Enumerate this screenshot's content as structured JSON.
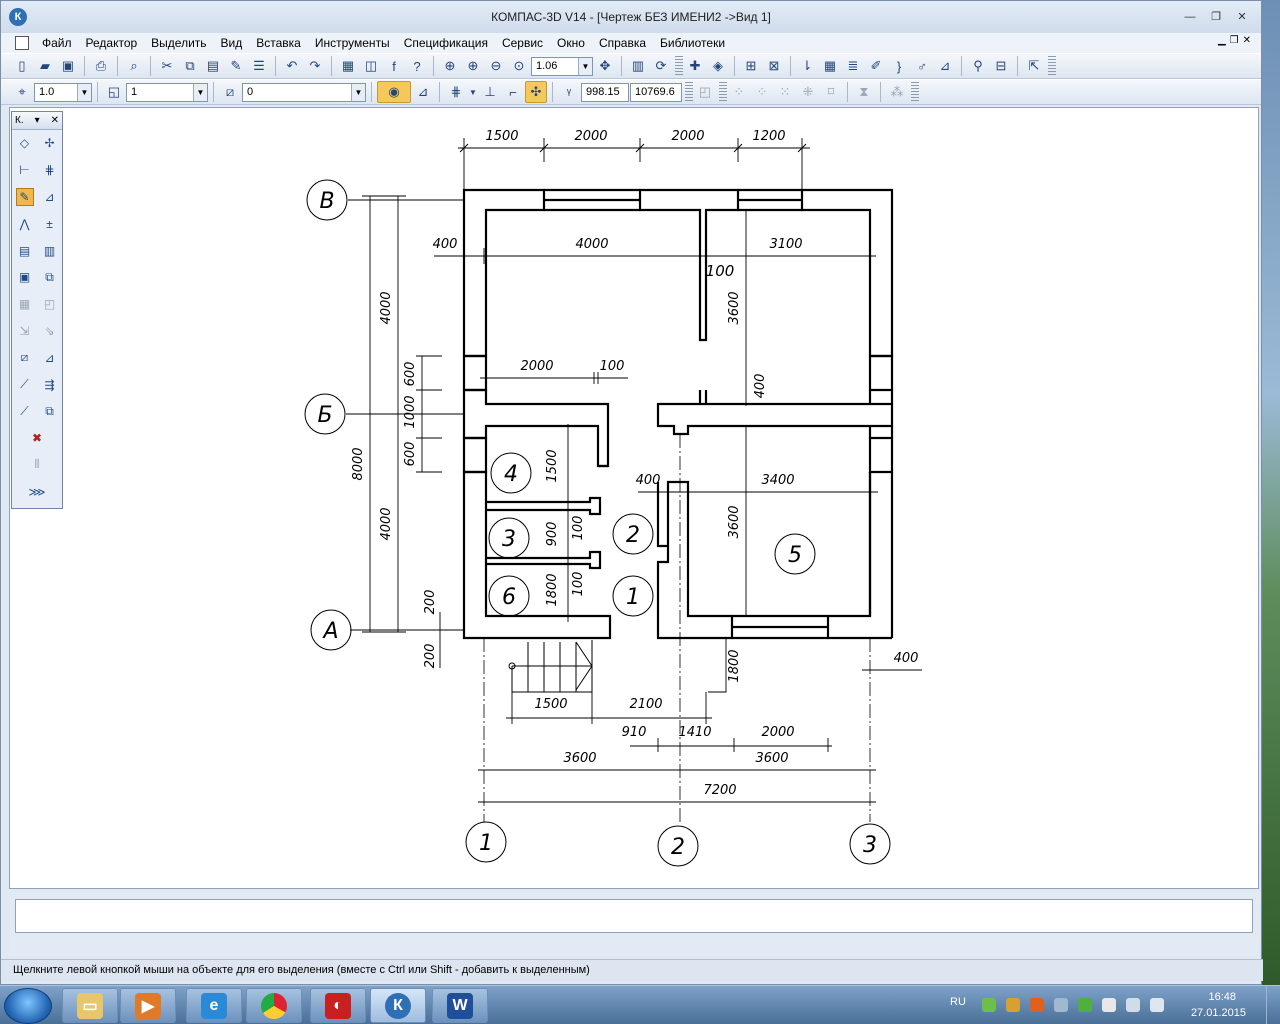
{
  "window": {
    "title": "КОМПАС-3D V14 - [Чертеж БЕЗ ИМЕНИ2 ->Вид 1]",
    "logo": "К"
  },
  "menu": [
    "Файл",
    "Редактор",
    "Выделить",
    "Вид",
    "Вставка",
    "Инструменты",
    "Спецификация",
    "Сервис",
    "Окно",
    "Справка",
    "Библиотеки"
  ],
  "toolbar1": {
    "zoom_value": "1.06"
  },
  "toolbar2": {
    "scale_value": "1.0",
    "layer_value": "1",
    "style_value": "0",
    "coord_x": "998.15",
    "coord_y": "10769.6"
  },
  "panel": {
    "title": "К."
  },
  "status": {
    "hint": "Щелкните левой кнопкой мыши на объекте для его выделения (вместе с Ctrl или Shift - добавить к выделенным)"
  },
  "taskbar": {
    "lang": "RU",
    "time": "16:48",
    "date": "27.01.2015"
  },
  "drawing": {
    "axes_letters": [
      "В",
      "Б",
      "А"
    ],
    "axes_numbers": [
      "1",
      "2",
      "3"
    ],
    "rooms": [
      "1",
      "2",
      "3",
      "4",
      "5",
      "6"
    ],
    "dims": {
      "top": [
        "1500",
        "2000",
        "2000",
        "1200"
      ],
      "d400a": "400",
      "d4000": "4000",
      "d3100": "3100",
      "d100a": "100",
      "d3600a": "3600",
      "d2000m": "2000",
      "d100m": "100",
      "d400v": "400",
      "d400b": "400",
      "d3400": "3400",
      "d3600b": "3600",
      "d1500v": "1500",
      "d900": "900",
      "d100b": "100",
      "d1800": "1800",
      "d100c": "100",
      "left_4000a": "4000",
      "left_4000b": "4000",
      "left_8000": "8000",
      "left_600a": "600",
      "left_1000": "1000",
      "left_600b": "600",
      "d200a": "200",
      "d200b": "200",
      "d1500b": "1500",
      "d2100": "2100",
      "d1800b": "1800",
      "d400r": "400",
      "d910": "910",
      "d1410": "1410",
      "d2000b": "2000",
      "d3600l": "3600",
      "d3600r": "3600",
      "d7200": "7200"
    }
  }
}
